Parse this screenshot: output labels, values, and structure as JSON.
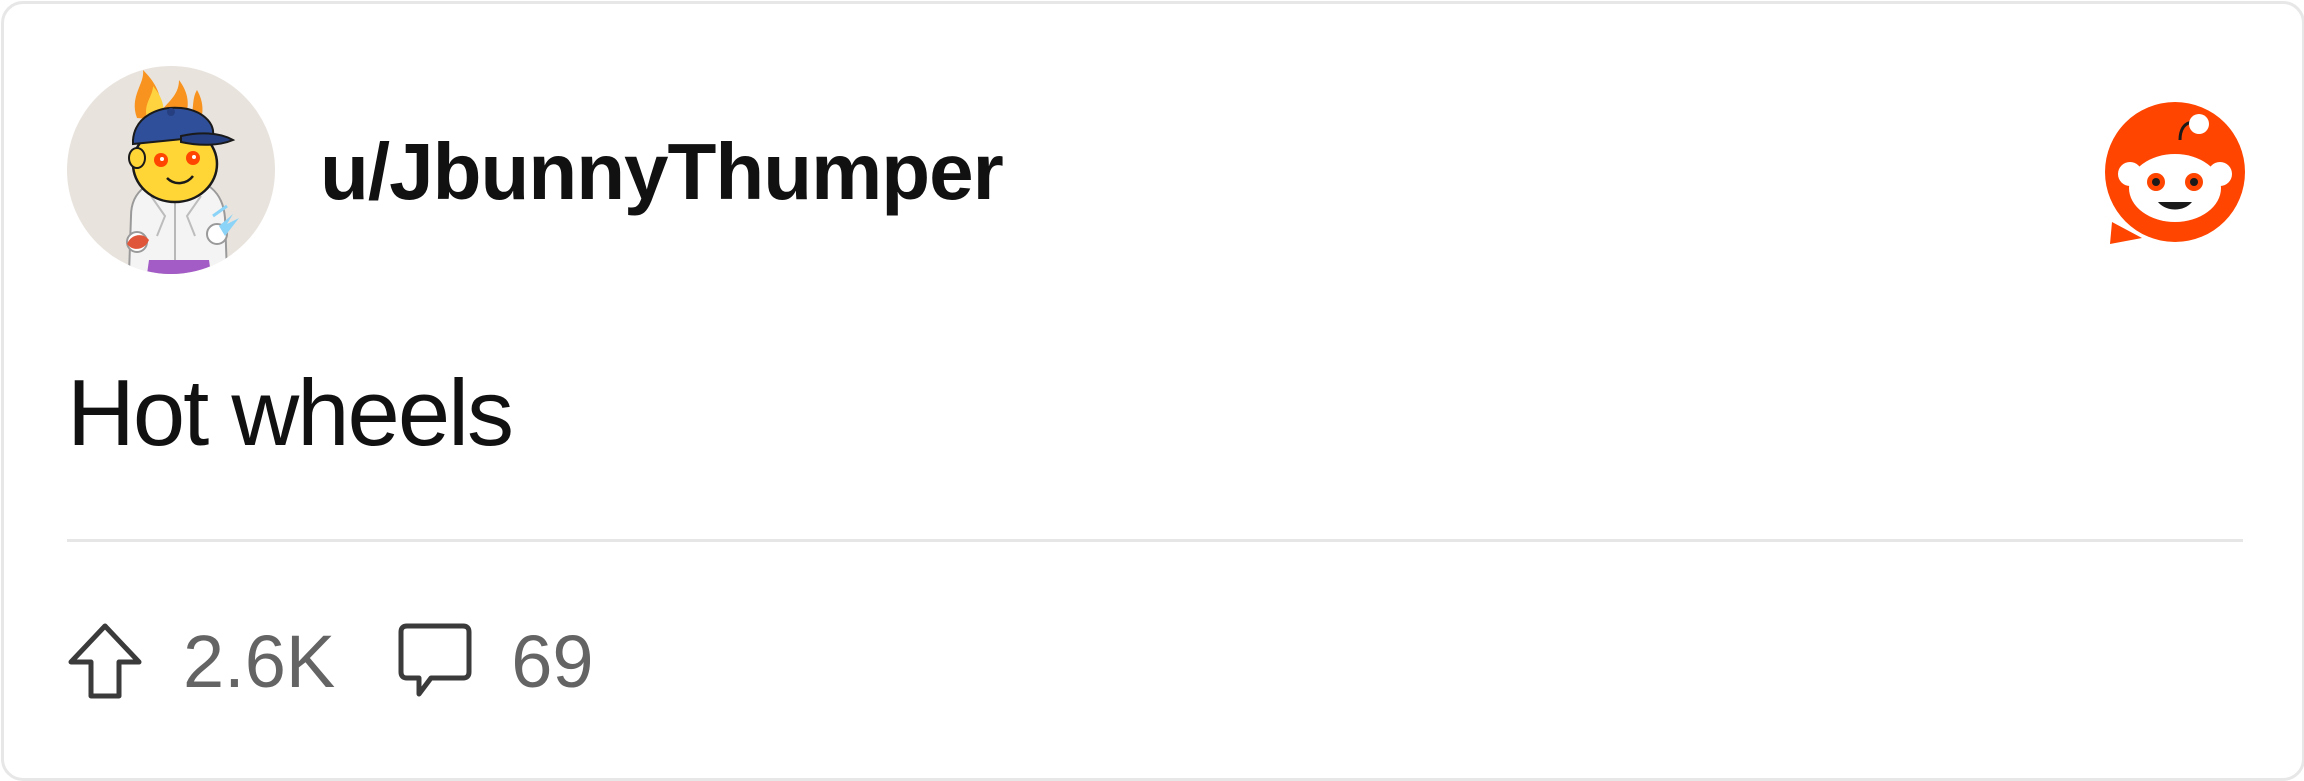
{
  "post": {
    "author": "u/JbunnyThumper",
    "title": "Hot wheels",
    "upvotes": "2.6K",
    "comments": "69"
  },
  "icons": {
    "avatar": "user-avatar-snoo",
    "brand": "reddit-logo-icon",
    "upvote": "upvote-arrow-icon",
    "comment": "comment-bubble-icon"
  },
  "colors": {
    "brand_orange": "#ff4500",
    "text_primary": "#111111",
    "text_secondary": "#646464",
    "border": "#e7e7e7"
  }
}
